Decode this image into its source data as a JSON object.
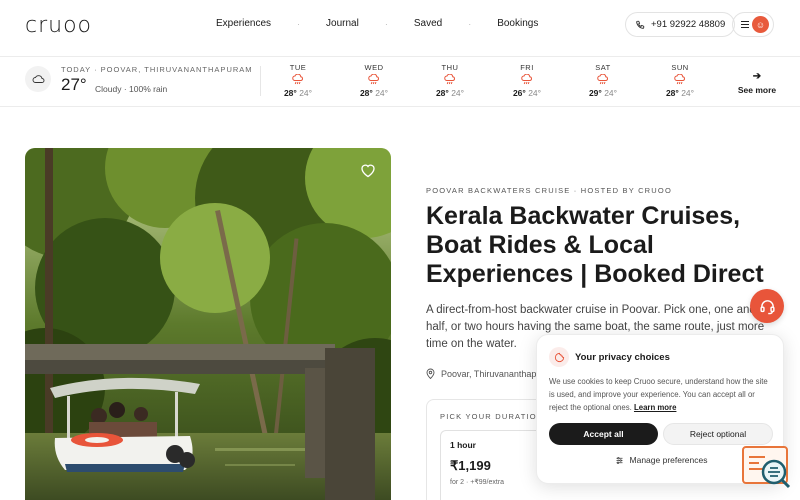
{
  "header": {
    "logo": "cruoo",
    "nav": [
      "Experiences",
      "Journal",
      "Saved",
      "Bookings"
    ],
    "separator": "·",
    "phone": "+91 92922 48809",
    "avatar_initial": "☺"
  },
  "weather": {
    "today_label": "TODAY · POOVAR, THIRUVANANTHAPURAM",
    "temp": "27°",
    "desc": "Cloudy · 100% rain",
    "days": [
      {
        "name": "TUE",
        "hi": "28°",
        "lo": "24°"
      },
      {
        "name": "WED",
        "hi": "28°",
        "lo": "24°"
      },
      {
        "name": "THU",
        "hi": "28°",
        "lo": "24°"
      },
      {
        "name": "FRI",
        "hi": "26°",
        "lo": "24°"
      },
      {
        "name": "SAT",
        "hi": "29°",
        "lo": "24°"
      },
      {
        "name": "SUN",
        "hi": "28°",
        "lo": "24°"
      }
    ],
    "see_more": "See more",
    "rain_color": "#e8553a"
  },
  "listing": {
    "eyebrow": "POOVAR BACKWATERS CRUISE · HOSTED BY CRUOO",
    "title": "Kerala Backwater Cruises, Boat Rides & Local Experiences | Booked Direct",
    "description": "A direct-from-host backwater cruise in Poovar. Pick one, one and a half, or two hours having the same boat, the same route, just more time on the water.",
    "location": "Poovar, Thiruvananthapu",
    "duration_label": "PICK YOUR DURATION",
    "option": {
      "hours": "1 hour",
      "price": "₹1,199",
      "sub": "for 2 · +₹99/extra"
    }
  },
  "cookie": {
    "title": "Your privacy choices",
    "text": "We use cookies to keep Cruoo secure, understand how the site is used, and improve your experience. You can accept all or reject the optional ones.",
    "link": "Learn more",
    "accept": "Accept all",
    "reject": "Reject optional",
    "manage": "Manage preferences"
  },
  "colors": {
    "accent": "#e8553a",
    "dark": "#1b1b1b"
  }
}
